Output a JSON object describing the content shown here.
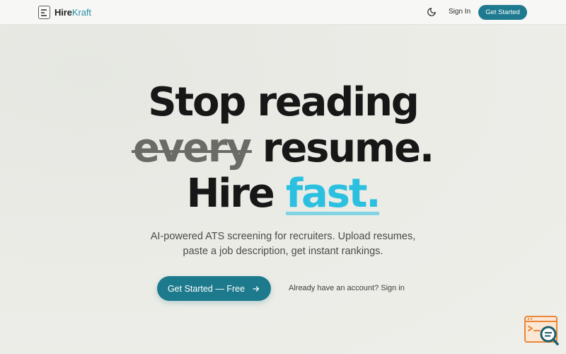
{
  "brand": {
    "name_part1": "Hire",
    "name_part2": "Kraft"
  },
  "nav": {
    "theme_toggle_icon": "moon-icon",
    "signin_label": "Sign In",
    "cta_label": "Get Started"
  },
  "hero": {
    "line1": "Stop reading",
    "line2_struck": "every",
    "line2_rest": " resume.",
    "line3_prefix": "Hire ",
    "line3_highlight": "fast.",
    "subtitle_line1": "AI-powered ATS screening for recruiters. Upload resumes,",
    "subtitle_line2": "paste a job description, get instant rankings.",
    "cta_label": "Get Started — Free",
    "cta_icon": "arrow-right-icon",
    "account_text": "Already have an account? ",
    "account_link": "Sign in"
  },
  "widget": {
    "icon": "search-document-icon"
  },
  "colors": {
    "accent": "#1e7a8f",
    "highlight": "#2cc0e0",
    "widget_orange": "#e8883a"
  }
}
